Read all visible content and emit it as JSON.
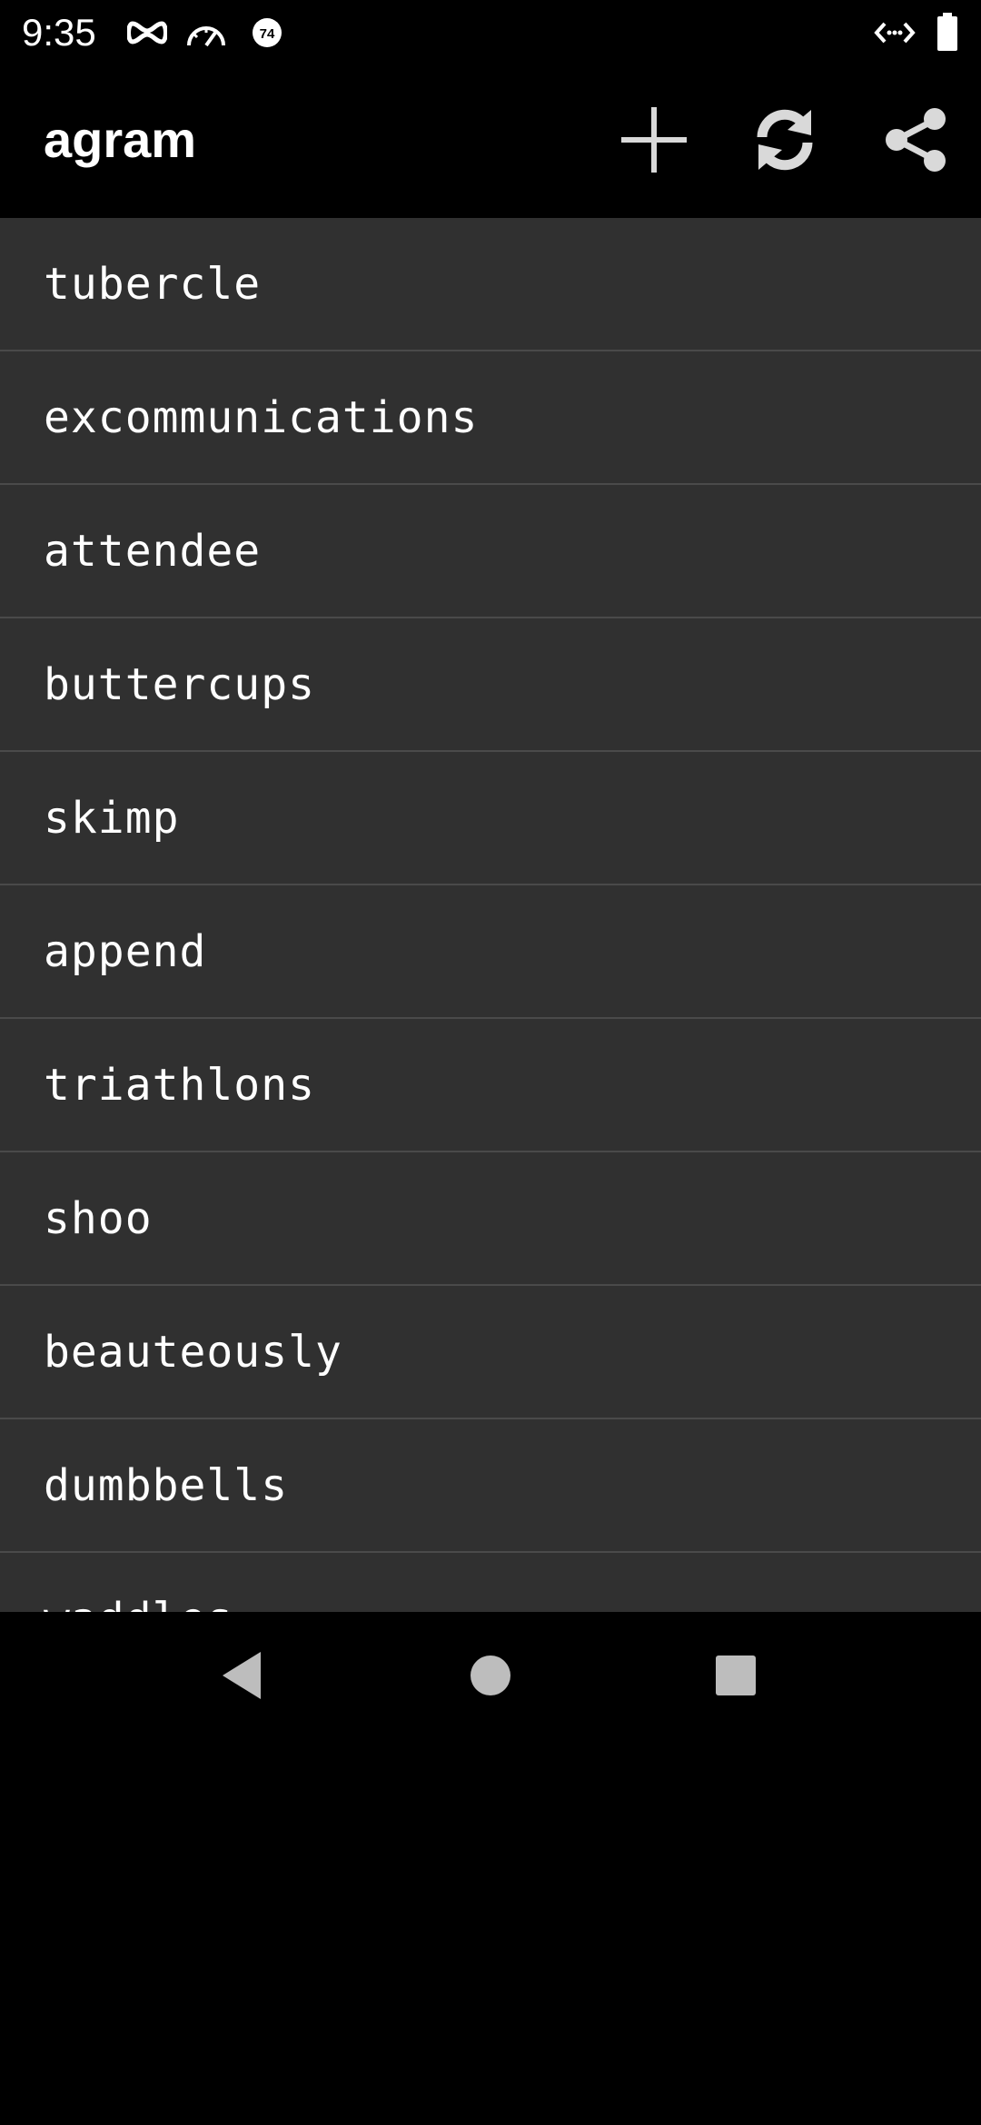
{
  "status_bar": {
    "time": "9:35",
    "icons_left": [
      "incognito-icon",
      "speedometer-icon",
      "badge-74-icon"
    ],
    "badge_text": "74",
    "icons_right": [
      "data-arrows-icon",
      "battery-icon"
    ]
  },
  "app_bar": {
    "title": "agram",
    "actions": [
      "add-icon",
      "refresh-icon",
      "share-icon"
    ]
  },
  "words": [
    "tubercle",
    "excommunications",
    "attendee",
    "buttercups",
    "skimp",
    "append",
    "triathlons",
    "shoo",
    "beauteously",
    "dumbbells",
    "waddles"
  ],
  "nav_bar": {
    "buttons": [
      "back-icon",
      "home-icon",
      "recents-icon"
    ]
  },
  "colors": {
    "background": "#000000",
    "list_background": "#303030",
    "divider": "#4a4a4a",
    "text": "#ffffff",
    "icon": "#d9d9d9",
    "nav_icon": "#bdbdbd"
  }
}
